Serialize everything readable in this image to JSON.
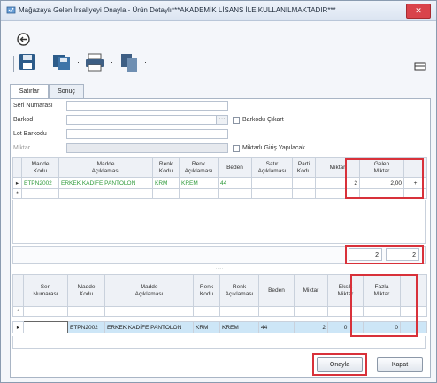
{
  "window": {
    "title": "Mağazaya Gelen İrsaliyeyi Onayla - Ürün Detaylı***AKADEMİK LİSANS İLE KULLANILMAKTADIR***",
    "close_glyph": "✕"
  },
  "toolbar": {
    "icons": [
      "save-icon",
      "save-all-icon",
      "print-icon",
      "copy-icon",
      "exit-icon"
    ]
  },
  "tabs": [
    {
      "label": "Satırlar",
      "active": true
    },
    {
      "label": "Sonuç",
      "active": false
    }
  ],
  "form": {
    "seri_label": "Seri Numarası",
    "barkod_label": "Barkod",
    "barkod_cikart_label": "Barkodu Çıkart",
    "lot_barkodu_label": "Lot Barkodu",
    "miktar_label": "Miktar",
    "miktarli_giris_label": "Miktarlı Giriş Yapılacak"
  },
  "top_grid": {
    "columns": [
      "Madde\nKodu",
      "Madde\nAçıklaması",
      "Renk\nKodu",
      "Renk\nAçıklaması",
      "Beden",
      "Satır\nAçıklaması",
      "Parti\nKodu",
      "Miktar",
      "Gelen\nMiktar"
    ],
    "rows": [
      {
        "madde_kodu": "ETPN2002",
        "madde_aciklamasi": "ERKEK KADİFE PANTOLON",
        "renk_kodu": "KRM",
        "renk_aciklamasi": "KREM",
        "beden": "44",
        "satir_aciklamasi": "",
        "parti_kodu": "",
        "miktar": "2",
        "gelen_miktar": "2,00"
      }
    ],
    "new_row_marker": "*",
    "current_row_marker": "▸",
    "totals": {
      "miktar": "2",
      "gelen_miktar": "2"
    }
  },
  "bottom_grid": {
    "columns": [
      "Seri\nNumarası",
      "Madde\nKodu",
      "Madde\nAçıklaması",
      "Renk\nKodu",
      "Renk\nAçıklaması",
      "Beden",
      "Miktar",
      "Eksik\nMiktar",
      "Fazla\nMiktar"
    ],
    "rows": [
      {
        "seri_numarasi": "",
        "madde_kodu": "ETPN2002",
        "madde_aciklamasi": "ERKEK KADİFE PANTOLON",
        "renk_kodu": "KRM",
        "renk_aciklamasi": "KREM",
        "beden": "44",
        "miktar": "2",
        "eksik_miktar": "0",
        "fazla_miktar": "0"
      }
    ],
    "new_row_marker": "*",
    "current_row_marker": "▸"
  },
  "buttons": {
    "onayla": "Onayla",
    "kapat": "Kapat"
  },
  "colors": {
    "highlight_red": "#d8313a",
    "green_text": "#2e9a3a",
    "selected_row": "#cde6f7"
  }
}
